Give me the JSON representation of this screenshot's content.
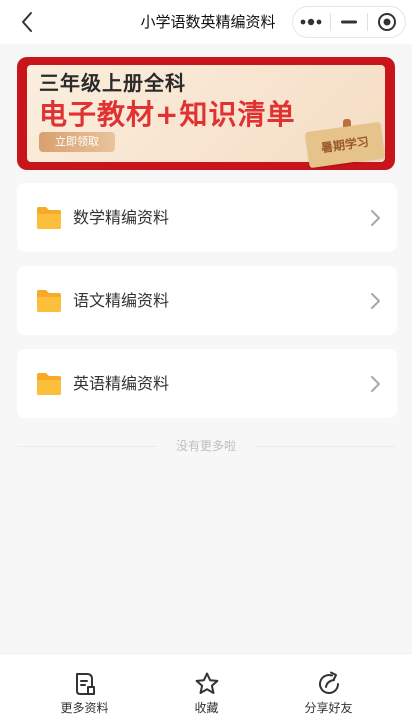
{
  "header": {
    "title": "小学语数英精编资料",
    "back_icon": "chevron-left-icon",
    "more_icon": "more-dots-icon",
    "minimize_icon": "minus-icon",
    "close_icon": "target-circle-icon"
  },
  "banner": {
    "line1": "三年级上册全科",
    "line2": "电子教材+知识清单",
    "cta": "立即领取",
    "stamp": "暑期学习",
    "accent_color": "#c8141b",
    "headline_color": "#e03232"
  },
  "items": [
    {
      "label": "数学精编资料",
      "icon": "folder-icon"
    },
    {
      "label": "语文精编资料",
      "icon": "folder-icon"
    },
    {
      "label": "英语精编资料",
      "icon": "folder-icon"
    }
  ],
  "footer_note": "没有更多啦",
  "tabbar": {
    "tabs": [
      {
        "label": "更多资料",
        "icon": "document-icon"
      },
      {
        "label": "收藏",
        "icon": "star-icon"
      },
      {
        "label": "分享好友",
        "icon": "share-icon"
      }
    ]
  }
}
